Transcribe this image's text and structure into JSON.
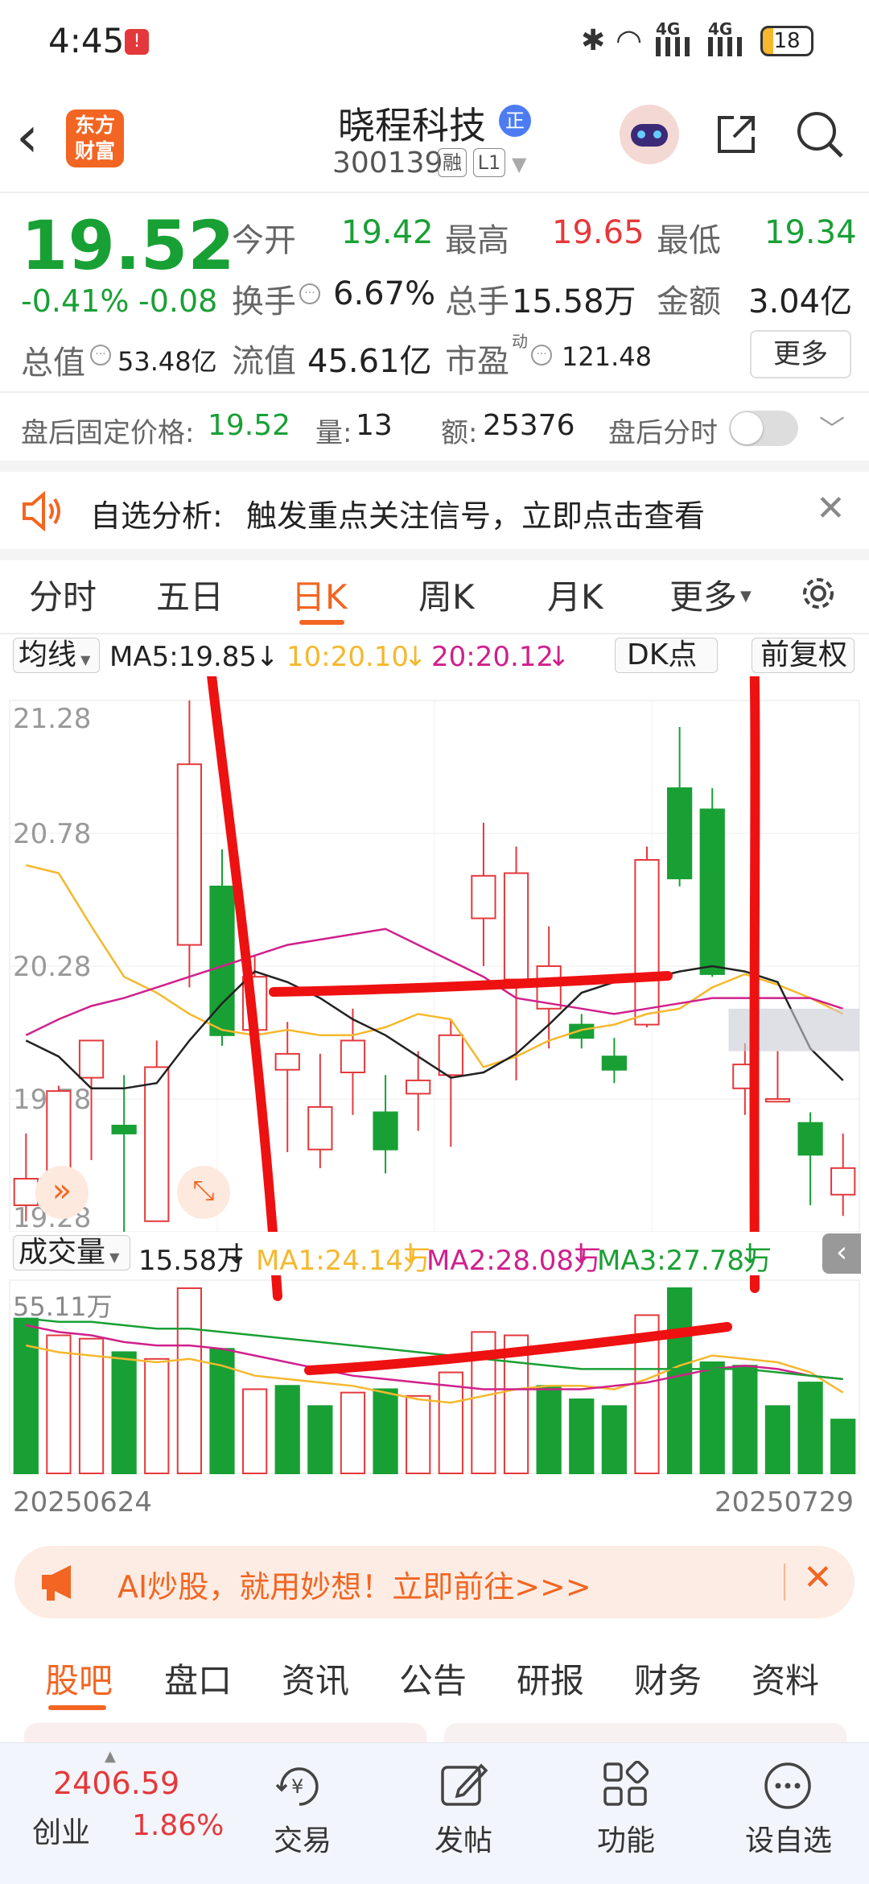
{
  "status_bar": {
    "time": "4:45",
    "battery": "18",
    "net1": "4G",
    "net2": "4G"
  },
  "header": {
    "brand_line1": "东方",
    "brand_line2": "财富",
    "name": "晓程科技",
    "name_badge": "正",
    "code": "300139",
    "rong": "融",
    "level": "L1"
  },
  "quote": {
    "price": "19.52",
    "change_pct": "-0.41%",
    "change": "-0.08",
    "open_label": "今开",
    "open": "19.42",
    "high_label": "最高",
    "high": "19.65",
    "low_label": "最低",
    "low": "19.34",
    "turnover_label": "换手",
    "turnover": "6.67%",
    "volume_label": "总手",
    "volume": "15.58万",
    "amount_label": "金额",
    "amount": "3.04亿",
    "mktcap_label": "总值",
    "mktcap": "53.48亿",
    "float_label": "流值",
    "float_cap": "45.61亿",
    "pe_label": "市盈",
    "pe_sup": "动",
    "pe": "121.48",
    "more_button": "更多"
  },
  "after_hours": {
    "price_label": "盘后固定价格:",
    "price": "19.52",
    "vol_label": "量:",
    "vol": "13",
    "amt_label": "额:",
    "amt": "25376",
    "toggle_label": "盘后分时"
  },
  "notice": {
    "label": "自选分析:",
    "text": "触发重点关注信号，立即点击查看"
  },
  "chart_tabs": [
    "分时",
    "五日",
    "日K",
    "周K",
    "月K",
    "更多"
  ],
  "chart_tabs_active": 2,
  "ma_bar": {
    "selector": "均线",
    "ma5": "MA5:19.85",
    "ma10": "10:20.10",
    "ma20": "20:20.12",
    "dk": "DK点",
    "fq": "前复权",
    "arrow": "↓"
  },
  "vol_bar": {
    "selector": "成交量",
    "vol": "15.58万",
    "ma1": "MA1:24.14万",
    "ma2": "MA2:28.08万",
    "ma3": "MA3:27.78万",
    "arrow": "↓",
    "ymax": "55.11万"
  },
  "date_start": "20250624",
  "date_end": "20250729",
  "chart_data": {
    "type": "candlestick",
    "ylim": [
      19.28,
      21.28
    ],
    "yticks": [
      "21.28",
      "20.78",
      "20.28",
      "19.78",
      "19.28"
    ],
    "candles": [
      {
        "o": 19.48,
        "c": 19.38,
        "h": 19.65,
        "l": 19.32,
        "up": true
      },
      {
        "o": 19.41,
        "c": 19.81,
        "h": 19.83,
        "l": 19.39,
        "up": true
      },
      {
        "o": 19.86,
        "c": 20.0,
        "h": 20.0,
        "l": 19.55,
        "up": true
      },
      {
        "o": 19.68,
        "c": 19.65,
        "h": 19.87,
        "l": 19.24,
        "up": false
      },
      {
        "o": 19.32,
        "c": 19.9,
        "h": 20.0,
        "l": 19.32,
        "up": true
      },
      {
        "o": 20.36,
        "c": 21.04,
        "h": 21.28,
        "l": 20.2,
        "up": true
      },
      {
        "o": 20.58,
        "c": 20.02,
        "h": 20.72,
        "l": 19.98,
        "up": false
      },
      {
        "o": 20.04,
        "c": 20.24,
        "h": 20.32,
        "l": 19.88,
        "up": true
      },
      {
        "o": 19.95,
        "c": 19.89,
        "h": 20.07,
        "l": 19.58,
        "up": true
      },
      {
        "o": 19.59,
        "c": 19.75,
        "h": 19.95,
        "l": 19.52,
        "up": true
      },
      {
        "o": 19.88,
        "c": 20.0,
        "h": 20.12,
        "l": 19.72,
        "up": true
      },
      {
        "o": 19.73,
        "c": 19.59,
        "h": 19.87,
        "l": 19.5,
        "up": false
      },
      {
        "o": 19.8,
        "c": 19.85,
        "h": 19.96,
        "l": 19.66,
        "up": true
      },
      {
        "o": 19.87,
        "c": 20.02,
        "h": 20.08,
        "l": 19.6,
        "up": true
      },
      {
        "o": 20.46,
        "c": 20.62,
        "h": 20.82,
        "l": 20.28,
        "up": true
      },
      {
        "o": 20.23,
        "c": 20.63,
        "h": 20.73,
        "l": 19.85,
        "up": true
      },
      {
        "o": 20.12,
        "c": 20.28,
        "h": 20.43,
        "l": 19.97,
        "up": true
      },
      {
        "o": 20.06,
        "c": 20.01,
        "h": 20.1,
        "l": 19.97,
        "up": false
      },
      {
        "o": 19.94,
        "c": 19.89,
        "h": 20.01,
        "l": 19.84,
        "up": false
      },
      {
        "o": 20.06,
        "c": 20.68,
        "h": 20.73,
        "l": 20.05,
        "up": true
      },
      {
        "o": 20.95,
        "c": 20.61,
        "h": 21.18,
        "l": 20.58,
        "up": false
      },
      {
        "o": 20.87,
        "c": 20.25,
        "h": 20.95,
        "l": 20.24,
        "up": false
      },
      {
        "o": 19.91,
        "c": 19.82,
        "h": 19.99,
        "l": 19.72,
        "up": true
      },
      {
        "o": 19.78,
        "c": 19.77,
        "h": 19.96,
        "l": 19.78,
        "up": true
      },
      {
        "o": 19.69,
        "c": 19.57,
        "h": 19.73,
        "l": 19.38,
        "up": false
      },
      {
        "o": 19.52,
        "c": 19.42,
        "h": 19.65,
        "l": 19.34,
        "up": true
      }
    ],
    "ma5": [
      20.0,
      19.94,
      19.82,
      19.82,
      19.84,
      20.0,
      20.14,
      20.26,
      20.22,
      20.16,
      20.08,
      20.02,
      19.94,
      19.86,
      19.88,
      19.95,
      20.06,
      20.18,
      20.22,
      20.23,
      20.26,
      20.28,
      20.26,
      20.22,
      19.97,
      19.85
    ],
    "ma10": [
      20.66,
      20.63,
      20.43,
      20.24,
      20.18,
      20.1,
      20.04,
      20.02,
      20.04,
      20.02,
      20.02,
      20.05,
      20.1,
      20.08,
      19.9,
      19.94,
      20.0,
      20.04,
      20.06,
      20.1,
      20.12,
      20.2,
      20.25,
      20.21,
      20.16,
      20.1
    ],
    "ma20": [
      20.02,
      20.08,
      20.13,
      20.16,
      20.2,
      20.24,
      20.28,
      20.32,
      20.36,
      20.38,
      20.4,
      20.42,
      20.36,
      20.3,
      20.24,
      20.16,
      20.14,
      20.12,
      20.1,
      20.12,
      20.14,
      20.16,
      20.16,
      20.16,
      20.16,
      20.12
    ],
    "volume": [
      {
        "v": 46,
        "up": false
      },
      {
        "v": 41,
        "up": true
      },
      {
        "v": 40,
        "up": true
      },
      {
        "v": 36,
        "up": false
      },
      {
        "v": 34,
        "up": true
      },
      {
        "v": 55,
        "up": true
      },
      {
        "v": 37,
        "up": false
      },
      {
        "v": 25,
        "up": true
      },
      {
        "v": 26,
        "up": false
      },
      {
        "v": 20,
        "up": false
      },
      {
        "v": 24,
        "up": true
      },
      {
        "v": 25,
        "up": false
      },
      {
        "v": 23,
        "up": true
      },
      {
        "v": 30,
        "up": true
      },
      {
        "v": 42,
        "up": true
      },
      {
        "v": 41,
        "up": true
      },
      {
        "v": 26,
        "up": false
      },
      {
        "v": 22,
        "up": false
      },
      {
        "v": 20,
        "up": false
      },
      {
        "v": 47,
        "up": true
      },
      {
        "v": 55,
        "up": false
      },
      {
        "v": 33,
        "up": false
      },
      {
        "v": 32,
        "up": false
      },
      {
        "v": 20,
        "up": false
      },
      {
        "v": 27,
        "up": false
      },
      {
        "v": 16,
        "up": false
      }
    ],
    "vol_ma1": [
      38,
      36,
      35,
      34,
      33,
      34,
      32,
      29,
      28,
      27,
      26,
      24,
      22,
      21,
      23,
      25,
      26,
      26,
      25,
      28,
      32,
      35,
      34,
      33,
      30,
      24
    ],
    "vol_ma2": [
      44,
      42,
      41,
      39,
      38,
      38,
      37,
      35,
      33,
      31,
      29,
      28,
      27,
      26,
      25,
      25,
      25,
      25,
      26,
      27,
      29,
      31,
      32,
      31,
      29,
      28
    ],
    "vol_ma3": [
      46,
      45,
      45,
      44,
      43,
      43,
      42,
      41,
      40,
      39,
      38,
      37,
      36,
      35,
      34,
      33,
      32,
      31,
      31,
      31,
      31,
      31,
      31,
      30,
      29,
      28
    ]
  },
  "ai_banner": {
    "text": "AI炒股，就用妙想！立即前往>>>"
  },
  "bottom_tabs": [
    "股吧",
    "盘口",
    "资讯",
    "公告",
    "研报",
    "财务",
    "资料"
  ],
  "bottom_tabs_active": 0,
  "dock": {
    "index_value": "2406.59",
    "index_name": "创业",
    "index_pct": "1.86%",
    "trade": "交易",
    "post": "发帖",
    "func": "功能",
    "watch": "设自选"
  },
  "colors": {
    "up": "#e4393c",
    "down": "#19a035",
    "accent": "#f26522",
    "ma5": "#222222",
    "ma10": "#f5b82e",
    "ma20": "#d0208c"
  }
}
